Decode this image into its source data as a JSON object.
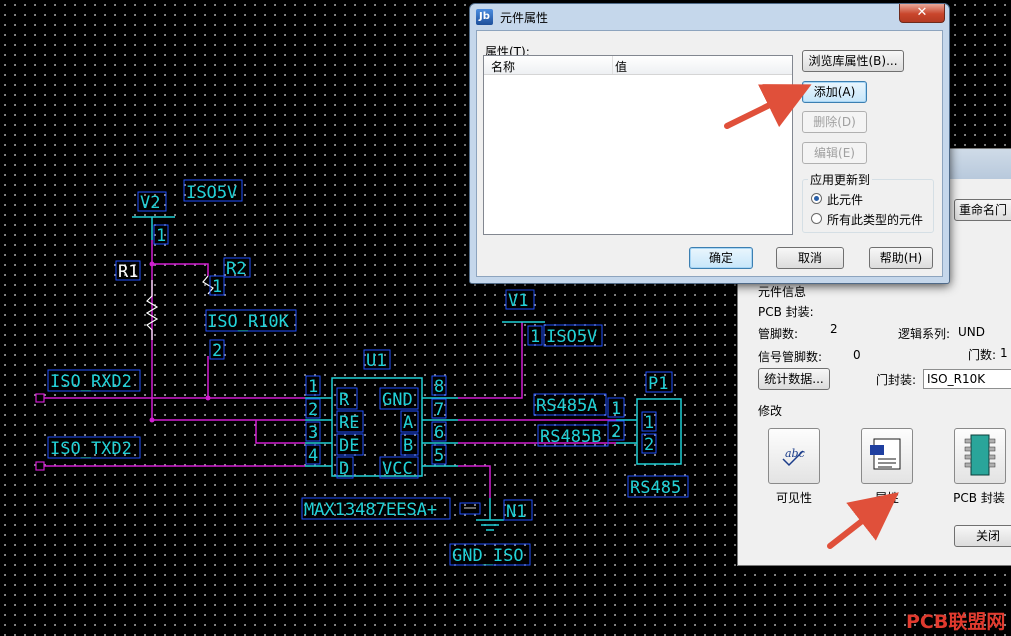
{
  "schematic": {
    "v2_label": "V2",
    "iso5v_top": "ISO5V",
    "pin1_v2": "1",
    "r1_label": "R1",
    "r2_label": "R2",
    "r2_pin1": "1",
    "r2_pin2": "2",
    "r2_value": "ISO_R10K",
    "v1_label": "V1",
    "v1_pin": "1",
    "iso5v_right": "ISO5V",
    "u1_label": "U1",
    "iso_rxd2": "ISO_RXD2",
    "iso_txd2": "ISO_TXD2",
    "pins_left": [
      "1",
      "2",
      "3",
      "4"
    ],
    "pins_right": [
      "8",
      "7",
      "6",
      "5"
    ],
    "ic_left_pins": [
      "R",
      "RE",
      "DE",
      "D"
    ],
    "ic_right_pins": [
      "GND",
      "A",
      "B",
      "VCC"
    ],
    "ic_part": "MAX13487EESA+",
    "rs485a": "RS485A",
    "rs485b": "RS485B",
    "p1_label": "P1",
    "p1_pins_out": [
      "1",
      "2"
    ],
    "p1_pins_in": [
      "1",
      "2"
    ],
    "p1_value": "RS485",
    "n1_label": "N1",
    "gnd_iso": "GND_ISO"
  },
  "part_dialog": {
    "rename_btn": "重命名门",
    "info_title": "元件信息",
    "pcb_footprint_label": "PCB 封装:",
    "pin_count_label": "管脚数:",
    "pin_count": "2",
    "logic_family_label": "逻辑系列:",
    "logic_family": "UND",
    "signal_pins_label": "信号管脚数:",
    "signal_pins": "0",
    "gates_label": "门数:",
    "gates": "1",
    "stats_btn": "统计数据...",
    "gate_footprint_label": "门封装:",
    "gate_footprint": "ISO_R10K",
    "modify_label": "修改",
    "visibility_label": "可见性",
    "attributes_label": "属性",
    "pcb_btn_label": "PCB 封装",
    "close_btn": "关闭"
  },
  "attr_dialog": {
    "title": "元件属性",
    "list_label": "属性(T):",
    "col_name": "名称",
    "col_value": "值",
    "browse_btn": "浏览库属性(B)...",
    "add_btn": "添加(A)",
    "delete_btn": "删除(D)",
    "edit_btn": "编辑(E)",
    "apply_group": "应用更新到",
    "radio_this": "此元件",
    "radio_all": "所有此类型的元件",
    "ok_btn": "确定",
    "cancel_btn": "取消",
    "help_btn": "帮助(H)"
  },
  "watermark": "PCB联盟网",
  "colors": {
    "wire": "#d21ed2",
    "label": "#1fd0d6",
    "highlight_box": "#1f4fff",
    "arrow": "#e0503a"
  }
}
